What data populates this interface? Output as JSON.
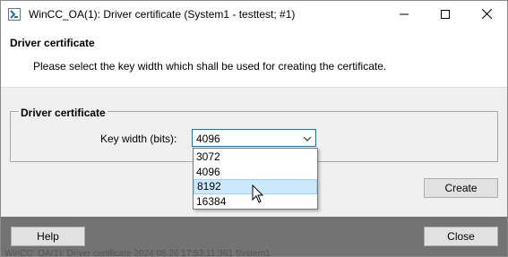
{
  "window": {
    "title": "WinCC_OA(1): Driver certificate (System1 - testtest; #1)"
  },
  "header": {
    "title": "Driver certificate",
    "description": "Please select the key width which shall be used for creating the certificate."
  },
  "group": {
    "title": "Driver certificate",
    "key_width_label": "Key width (bits):",
    "key_width_value": "4096",
    "options": [
      "3072",
      "4096",
      "8192",
      "16384"
    ],
    "hovered_option": "8192"
  },
  "buttons": {
    "create": "Create",
    "help": "Help",
    "close": "Close"
  },
  "footer": {
    "status": "WinCC_OA(1): Driver certificate 2024.08.26 17:53:11.361 System1"
  },
  "icons": {
    "app": "wincc-app-icon",
    "minimize": "minimize-icon",
    "maximize": "maximize-icon",
    "close": "close-icon",
    "dropdown": "chevron-down-icon",
    "cursor": "mouse-pointer-icon"
  },
  "colors": {
    "accent": "#0078d7",
    "hover": "#cce8ff",
    "footer_bg": "#737373"
  }
}
